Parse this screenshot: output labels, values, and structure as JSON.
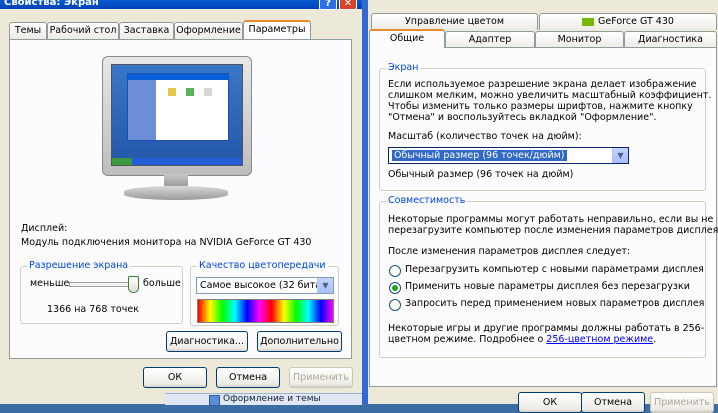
{
  "left_window": {
    "title": "Свойства: Экран",
    "tabs": [
      "Темы",
      "Рабочий стол",
      "Заставка",
      "Оформление",
      "Параметры"
    ],
    "display_label": "Дисплей:",
    "display_value": "Модуль подключения монитора на NVIDIA GeForce GT 430",
    "resolution": {
      "title": "Разрешение экрана",
      "less": "меньше",
      "more": "больше",
      "value": "1366 на 768 точек",
      "slider_level": 1.0
    },
    "color_quality": {
      "title": "Качество цветопередачи",
      "value": "Самое высокое (32 бита)"
    },
    "buttons": {
      "diagnostics": "Диагностика...",
      "advanced": "Дополнительно",
      "ok": "ОК",
      "cancel": "Отмена",
      "apply": "Применить"
    }
  },
  "right_window": {
    "tabs_top": [
      "Управление цветом",
      "GeForce GT 430"
    ],
    "tabs_bottom": [
      "Общие",
      "Адаптер",
      "Монитор",
      "Диагностика"
    ],
    "screen_group": {
      "title": "Экран",
      "text_line1": "Если используемое разрешение экрана делает изображение",
      "text_line2": "слишком мелким, можно увеличить масштабный коэффициент.",
      "text_line3": "Чтобы изменить только размеры шрифтов, нажмите кнопку",
      "text_line4": "\"Отмена\" и воспользуйтесь вкладкой \"Оформление\".",
      "scale_label": "Масштаб (количество точек на дюйм):",
      "scale_value": "Обычный размер (96 точек/дюйм)",
      "scale_caption": "Обычный размер (96 точек на дюйм)"
    },
    "compat_group": {
      "title": "Совместимость",
      "text_line1": "Некоторые программы могут работать неправильно, если вы не",
      "text_line2": "перезагрузите компьютер после изменения параметров дисплея.",
      "after_change": "После изменения параметров дисплея следует:",
      "options": [
        "Перезагрузить компьютер с новыми параметрами дисплея",
        "Применить новые параметры дисплея без перезагрузки",
        "Запросить перед применением новых параметров дисплея"
      ],
      "selected_option": 1,
      "note_line1": "Некоторые игры и другие программы должны работать в 256-",
      "note_line2_prefix": "цветном режиме. Подробнее о ",
      "note_link": "256-цветном режиме",
      "note_line2_suffix": "."
    },
    "buttons": {
      "ok": "ОК",
      "cancel": "Отмена",
      "apply": "Применить"
    }
  },
  "taskbar": {
    "item1": "Оформление и темы"
  }
}
